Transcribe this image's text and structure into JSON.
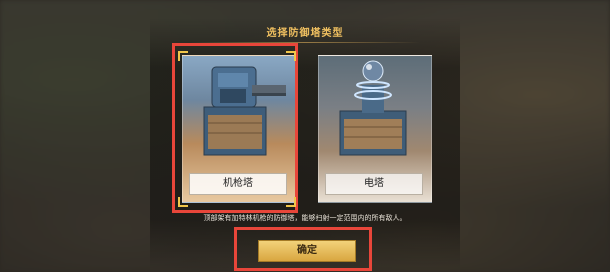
{
  "dialog": {
    "title": "选择防御塔类型",
    "options": [
      {
        "label": "机枪塔",
        "icon": "machine-gun-tower-icon",
        "selected": true
      },
      {
        "label": "电塔",
        "icon": "tesla-tower-icon",
        "selected": false
      }
    ],
    "description": "顶部架有加特林机枪的防御塔，能够扫射一定范围内的所有敌人。",
    "confirm_label": "确定"
  },
  "colors": {
    "highlight": "#e8463a",
    "title_gold": "#f0c060",
    "button_gold": "#d9a640"
  }
}
